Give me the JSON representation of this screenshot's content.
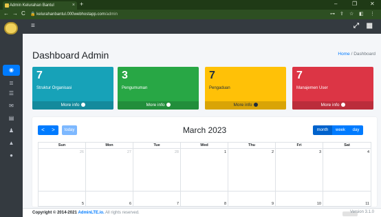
{
  "browser": {
    "tab_title": "Admin Kelurahan Bantul",
    "tab_close": "×",
    "new_tab": "+",
    "window_controls": [
      "–",
      "❐",
      "✕"
    ],
    "url_host": "kelurahanbantul.000webhostapp.com",
    "url_path": "/admin",
    "nav": [
      "←",
      "→",
      "C"
    ]
  },
  "topnav": {
    "menu_icon": "≡",
    "right_icons": [
      "⤢",
      "▦"
    ]
  },
  "sidebar": {
    "items": [
      {
        "icon": "dashboard-icon",
        "glyph": "◉",
        "active": true
      },
      {
        "icon": "sitemap-icon",
        "glyph": "≣",
        "active": false
      },
      {
        "icon": "list-icon",
        "glyph": "☰",
        "active": false
      },
      {
        "icon": "bullhorn-icon",
        "glyph": "✉",
        "active": false
      },
      {
        "icon": "inbox-icon",
        "glyph": "▤",
        "active": false
      },
      {
        "icon": "users-icon",
        "glyph": "♟",
        "active": false
      },
      {
        "icon": "lock-icon",
        "glyph": "🔒",
        "active": false
      },
      {
        "icon": "power-icon",
        "glyph": "⏻",
        "active": false
      }
    ]
  },
  "header": {
    "title": "Dashboard Admin",
    "breadcrumb_home": "Home",
    "breadcrumb_sep": "/",
    "breadcrumb_current": "Dashboard"
  },
  "boxes": [
    {
      "count": "7",
      "label": "Struktur Organisasi",
      "link": "More info",
      "color": "#17a2b8"
    },
    {
      "count": "3",
      "label": "Pengumuman",
      "link": "More info",
      "color": "#28a745"
    },
    {
      "count": "7",
      "label": "Pengaduan",
      "link": "More info",
      "color": "#ffc107"
    },
    {
      "count": "7",
      "label": "Manajemen User",
      "link": "More info",
      "color": "#dc3545"
    }
  ],
  "calendar": {
    "title": "March 2023",
    "prev": "<",
    "next": ">",
    "today": "today",
    "views": [
      "month",
      "week",
      "day"
    ],
    "weekdays": [
      "Sun",
      "Mon",
      "Tue",
      "Wed",
      "Thu",
      "Fri",
      "Sat"
    ],
    "week1": [
      {
        "day": "26",
        "other": true
      },
      {
        "day": "27",
        "other": true
      },
      {
        "day": "28",
        "other": true
      },
      {
        "day": "1",
        "other": false
      },
      {
        "day": "2",
        "other": false
      },
      {
        "day": "3",
        "other": false
      },
      {
        "day": "4",
        "other": false
      }
    ],
    "week2": [
      {
        "day": "5",
        "other": false
      },
      {
        "day": "6",
        "other": false
      },
      {
        "day": "7",
        "other": false
      },
      {
        "day": "8",
        "other": false
      },
      {
        "day": "9",
        "other": false
      },
      {
        "day": "10",
        "other": false
      },
      {
        "day": "11",
        "other": false
      }
    ]
  },
  "footer": {
    "copyright_prefix": "Copyright © 2014-2021",
    "brand": "AdminLTE.io.",
    "rights": "All rights reserved.",
    "version": "Version 3.1.0"
  },
  "colors": {
    "primary": "#007bff",
    "sidebar": "#343a40",
    "browser": "#2d4f22"
  }
}
